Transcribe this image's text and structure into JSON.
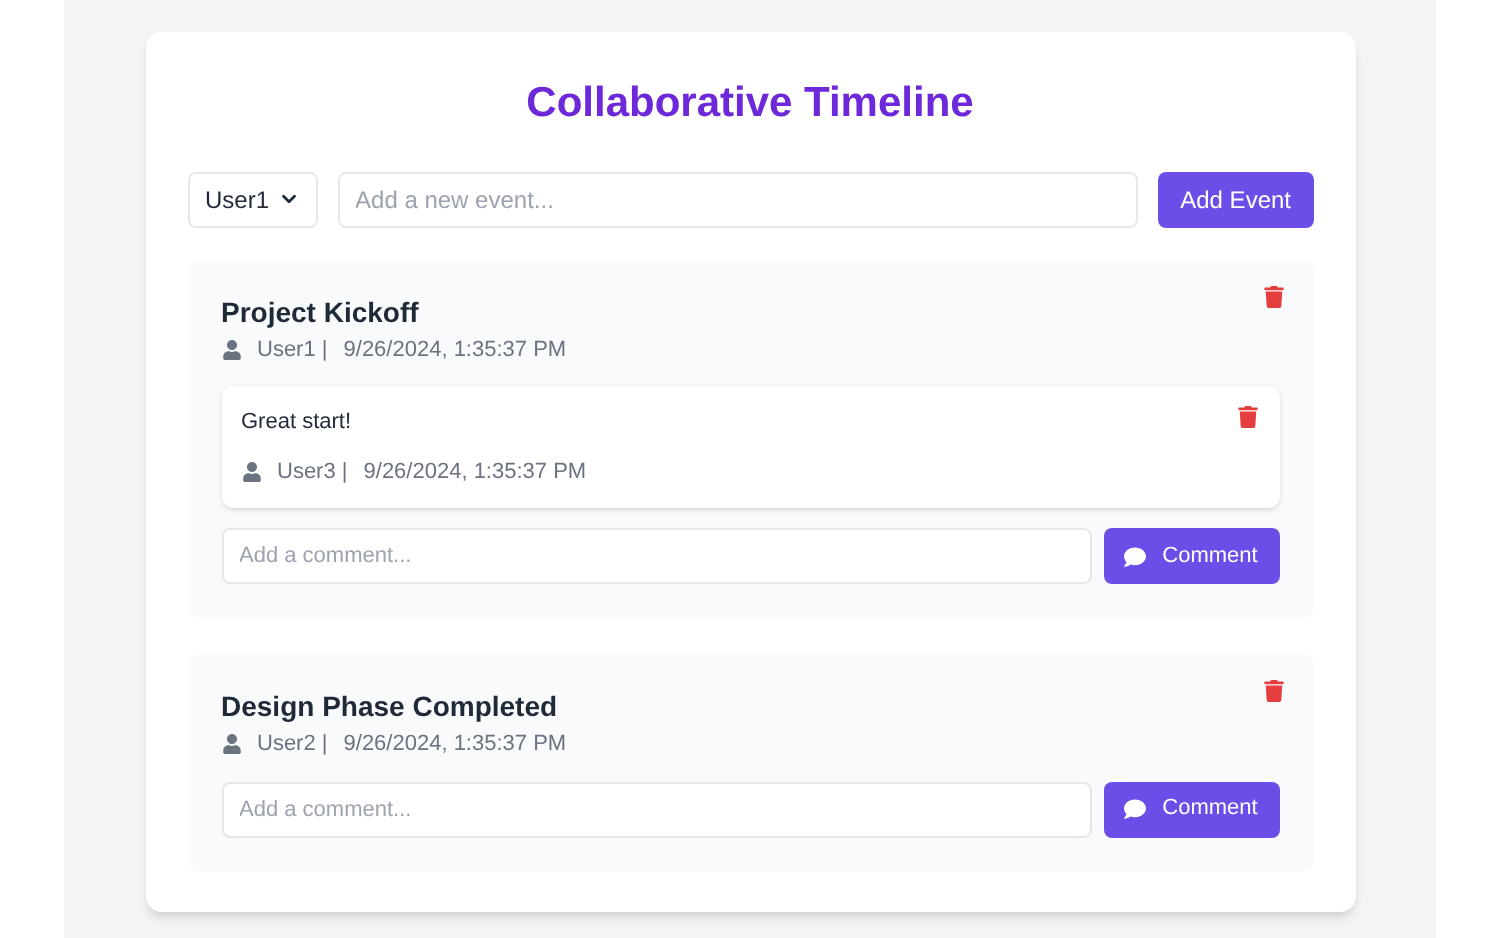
{
  "title": "Collaborative Timeline",
  "user_select": {
    "value": "User1"
  },
  "new_event": {
    "placeholder": "Add a new event..."
  },
  "add_button": "Add Event",
  "events": [
    {
      "title": "Project Kickoff",
      "author": "User1 |",
      "time": "9/26/2024, 1:35:37 PM",
      "comments": [
        {
          "text": "Great start!",
          "author": "User3 |",
          "time": "9/26/2024, 1:35:37 PM"
        }
      ],
      "comment_field": {
        "placeholder": "Add a comment..."
      },
      "comment_button": "Comment"
    },
    {
      "title": "Design Phase Completed",
      "author": "User2 |",
      "time": "9/26/2024, 1:35:37 PM",
      "comment_field": {
        "placeholder": "Add a comment..."
      },
      "comment_button": "Comment"
    }
  ]
}
